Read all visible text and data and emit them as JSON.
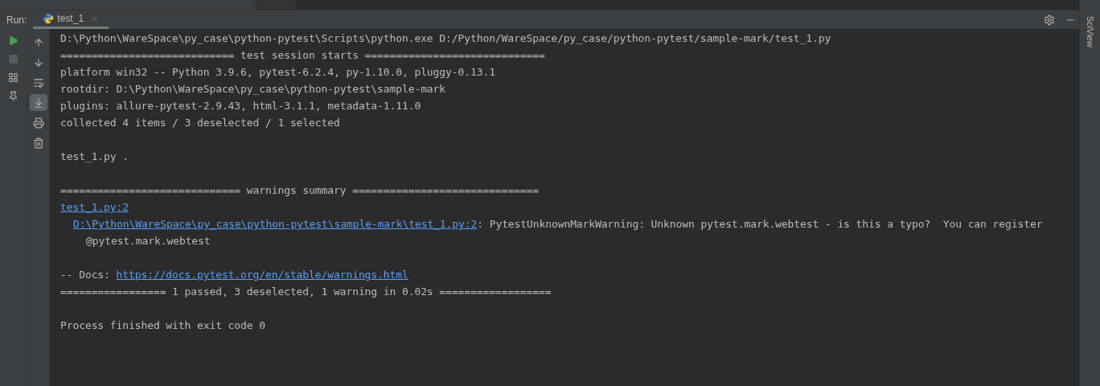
{
  "run_bar": {
    "label": "Run:",
    "tabs": [
      {
        "label": "test_1",
        "selected": true,
        "closable": true
      }
    ]
  },
  "left_toolbar": [
    {
      "kind": "play",
      "disabled": false
    },
    {
      "kind": "stop",
      "disabled": true
    },
    {
      "kind": "layout",
      "disabled": false
    },
    {
      "kind": "pin",
      "disabled": false
    }
  ],
  "console_toolbar": [
    {
      "kind": "up",
      "selected": false
    },
    {
      "kind": "down",
      "selected": false
    },
    {
      "kind": "wrap",
      "selected": false
    },
    {
      "kind": "scroll-end",
      "selected": true
    },
    {
      "kind": "print",
      "selected": false
    },
    {
      "kind": "trash",
      "selected": false
    }
  ],
  "side_panel": {
    "label": "SciView"
  },
  "console_blocks": [
    {
      "lines": [
        {
          "kind": "plain",
          "segments": [
            {
              "text": "D:\\Python\\WareSpace\\py_case\\python-pytest\\Scripts\\python.exe D:/Python/WareSpace/py_case/python-pytest/sample-mark/test_1.py",
              "link": false
            }
          ]
        },
        {
          "kind": "plain",
          "segments": [
            {
              "text": "============================ test session starts =============================",
              "link": false
            }
          ]
        },
        {
          "kind": "plain",
          "segments": [
            {
              "text": "platform win32 -- Python 3.9.6, pytest-6.2.4, py-1.10.0, pluggy-0.13.1",
              "link": false
            }
          ]
        },
        {
          "kind": "plain",
          "segments": [
            {
              "text": "rootdir: D:\\Python\\WareSpace\\py_case\\python-pytest\\sample-mark",
              "link": false
            }
          ]
        },
        {
          "kind": "plain",
          "segments": [
            {
              "text": "plugins: allure-pytest-2.9.43, html-3.1.1, metadata-1.11.0",
              "link": false
            }
          ]
        },
        {
          "kind": "plain",
          "segments": [
            {
              "text": "collected 4 items / 3 deselected / 1 selected",
              "link": false
            }
          ]
        }
      ]
    },
    {
      "lines": [
        {
          "kind": "plain",
          "segments": [
            {
              "text": "test_1.py .",
              "link": false
            }
          ]
        }
      ]
    },
    {
      "lines": [
        {
          "kind": "plain",
          "segments": [
            {
              "text": "============================= warnings summary ==============================",
              "link": false
            }
          ]
        },
        {
          "kind": "plain",
          "segments": [
            {
              "text": "test_1.py:2",
              "link": true
            }
          ]
        },
        {
          "kind": "location",
          "segments": [
            {
              "text": "D:\\Python\\WareSpace\\py_case\\python-pytest\\sample-mark\\test_1.py:2",
              "link": true
            },
            {
              "text": ": PytestUnknownMarkWarning: Unknown pytest.mark.webtest - is this a typo?  You can register",
              "link": false
            }
          ]
        },
        {
          "kind": "code",
          "segments": [
            {
              "text": "@pytest.mark.webtest",
              "link": false
            }
          ]
        }
      ]
    },
    {
      "lines": [
        {
          "kind": "plain",
          "segments": [
            {
              "text": "-- Docs: ",
              "link": false
            },
            {
              "text": "https://docs.pytest.org/en/stable/warnings.html",
              "link": true
            }
          ]
        },
        {
          "kind": "plain",
          "segments": [
            {
              "text": "================= 1 passed, 3 deselected, 1 warning in 0.02s ==================",
              "link": false
            }
          ]
        }
      ]
    },
    {
      "lines": [
        {
          "kind": "plain",
          "segments": [
            {
              "text": "Process finished with exit code 0",
              "link": false
            }
          ]
        }
      ]
    }
  ]
}
